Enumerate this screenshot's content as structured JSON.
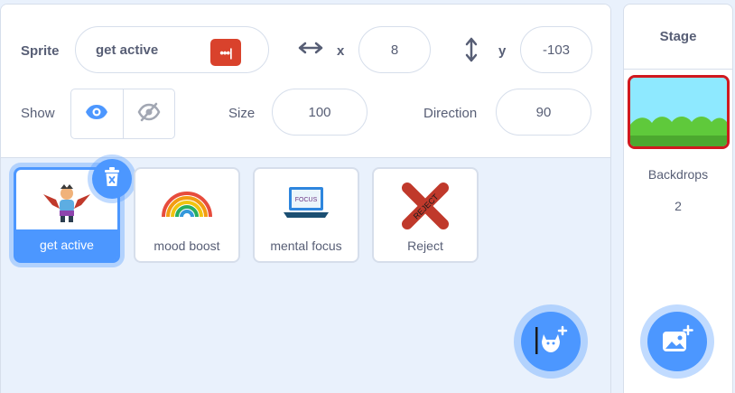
{
  "sprite_info": {
    "sprite_label": "Sprite",
    "sprite_name": "get active",
    "badge_text": "•••|",
    "x_label": "x",
    "x_value": "8",
    "y_label": "y",
    "y_value": "-103",
    "show_label": "Show",
    "size_label": "Size",
    "size_value": "100",
    "direction_label": "Direction",
    "direction_value": "90"
  },
  "sprites": [
    {
      "name": "get active",
      "selected": true,
      "icon": "person-sprite-icon"
    },
    {
      "name": "mood boost",
      "selected": false,
      "icon": "rainbow-sprite-icon"
    },
    {
      "name": "mental focus",
      "selected": false,
      "icon": "laptop-sprite-icon"
    },
    {
      "name": "Reject",
      "selected": false,
      "icon": "reject-x-sprite-icon"
    }
  ],
  "thumb_texts": {
    "focus": "FOCUS",
    "reject": "REJECT"
  },
  "stage": {
    "title": "Stage",
    "backdrops_label": "Backdrops",
    "backdrops_count": "2"
  },
  "colors": {
    "accent": "#4c97ff",
    "badge": "#d9422c",
    "stage_selection": "#d0191f",
    "text": "#575e75"
  }
}
